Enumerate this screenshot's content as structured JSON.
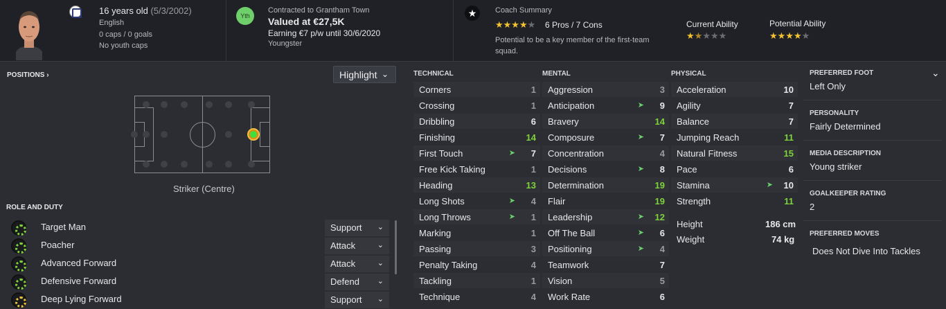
{
  "header": {
    "age": "16 years old",
    "dob": "(5/3/2002)",
    "nationality": "English",
    "caps": "0 caps / 0 goals",
    "youth_caps": "No youth caps",
    "yth_badge": "Yth",
    "contract": "Contracted to Grantham Town",
    "value": "Valued at €27,5K",
    "earning": "Earning €7 p/w until 30/6/2020",
    "status": "Youngster",
    "coach_title": "Coach Summary",
    "coach_stars": "★★★★",
    "coach_stars_empty": "★",
    "pros_cons": "6 Pros / 7 Cons",
    "coach_text": "Potential to be a key member of the first-team squad.",
    "ca_label": "Current Ability",
    "ca_stars": "★",
    "ca_half": "★",
    "ca_empty": "★★★",
    "pa_label": "Potential Ability",
    "pa_stars": "★★★★",
    "pa_empty": "★"
  },
  "positions": {
    "title": "POSITIONS ›",
    "highlight": "Highlight",
    "caption": "Striker (Centre)"
  },
  "roles": {
    "title": "ROLE AND DUTY",
    "items": [
      {
        "name": "Target Man",
        "duty": "Support"
      },
      {
        "name": "Poacher",
        "duty": "Attack"
      },
      {
        "name": "Advanced Forward",
        "duty": "Attack"
      },
      {
        "name": "Defensive Forward",
        "duty": "Defend"
      },
      {
        "name": "Deep Lying Forward",
        "duty": "Support"
      }
    ]
  },
  "technical": {
    "title": "TECHNICAL",
    "items": [
      {
        "name": "Corners",
        "value": "1"
      },
      {
        "name": "Crossing",
        "value": "1"
      },
      {
        "name": "Dribbling",
        "value": "6"
      },
      {
        "name": "Finishing",
        "value": "14"
      },
      {
        "name": "First Touch",
        "value": "7"
      },
      {
        "name": "Free Kick Taking",
        "value": "1"
      },
      {
        "name": "Heading",
        "value": "13"
      },
      {
        "name": "Long Shots",
        "value": "4"
      },
      {
        "name": "Long Throws",
        "value": "1"
      },
      {
        "name": "Marking",
        "value": "1"
      },
      {
        "name": "Passing",
        "value": "3"
      },
      {
        "name": "Penalty Taking",
        "value": "4"
      },
      {
        "name": "Tackling",
        "value": "1"
      },
      {
        "name": "Technique",
        "value": "4"
      }
    ]
  },
  "mental": {
    "title": "MENTAL",
    "items": [
      {
        "name": "Aggression",
        "value": "3"
      },
      {
        "name": "Anticipation",
        "value": "9"
      },
      {
        "name": "Bravery",
        "value": "14"
      },
      {
        "name": "Composure",
        "value": "7"
      },
      {
        "name": "Concentration",
        "value": "4"
      },
      {
        "name": "Decisions",
        "value": "8"
      },
      {
        "name": "Determination",
        "value": "19"
      },
      {
        "name": "Flair",
        "value": "19"
      },
      {
        "name": "Leadership",
        "value": "12"
      },
      {
        "name": "Off The Ball",
        "value": "6"
      },
      {
        "name": "Positioning",
        "value": "4"
      },
      {
        "name": "Teamwork",
        "value": "7"
      },
      {
        "name": "Vision",
        "value": "5"
      },
      {
        "name": "Work Rate",
        "value": "6"
      }
    ]
  },
  "physical": {
    "title": "PHYSICAL",
    "items": [
      {
        "name": "Acceleration",
        "value": "10"
      },
      {
        "name": "Agility",
        "value": "7"
      },
      {
        "name": "Balance",
        "value": "7"
      },
      {
        "name": "Jumping Reach",
        "value": "11"
      },
      {
        "name": "Natural Fitness",
        "value": "15"
      },
      {
        "name": "Pace",
        "value": "6"
      },
      {
        "name": "Stamina",
        "value": "10"
      },
      {
        "name": "Strength",
        "value": "11"
      }
    ],
    "height_label": "Height",
    "height": "186 cm",
    "weight_label": "Weight",
    "weight": "74 kg"
  },
  "info": {
    "foot_title": "PREFERRED FOOT",
    "foot": "Left Only",
    "personality_title": "PERSONALITY",
    "personality": "Fairly Determined",
    "media_title": "MEDIA DESCRIPTION",
    "media": "Young striker",
    "gk_title": "GOALKEEPER RATING",
    "gk": "2",
    "moves_title": "PREFERRED MOVES",
    "moves": "Does Not Dive Into Tackles"
  },
  "icons": {
    "arrow_glyph": "➤",
    "chevron": "⌄",
    "star": "★"
  },
  "colors": {
    "green": "#7fd23a",
    "gold": "#f2c230",
    "grey": "#9a9ba0"
  }
}
